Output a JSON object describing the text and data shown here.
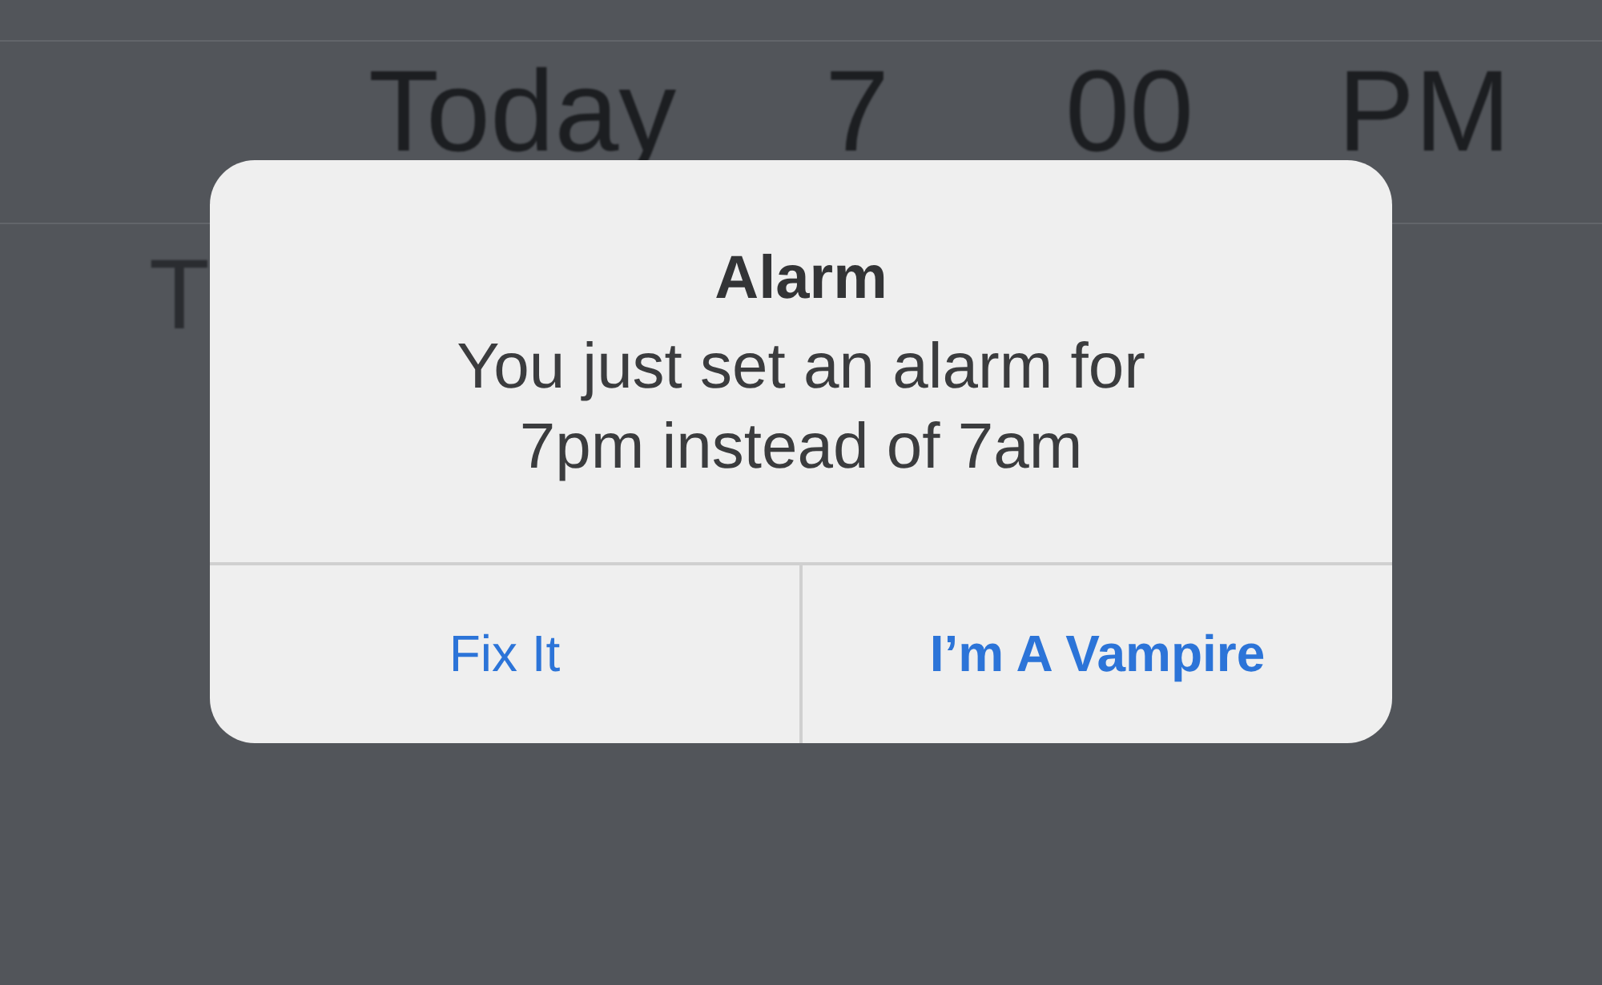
{
  "picker": {
    "rows": [
      {
        "selected": true,
        "cells": [
          "Today",
          "7",
          "00",
          "PM"
        ]
      },
      {
        "selected": false,
        "cells": [
          "T"
        ]
      }
    ]
  },
  "alert": {
    "title": "Alarm",
    "message": "You just set an alarm for\n7pm instead of 7am",
    "buttons": [
      {
        "label": "Fix It",
        "kind": "normal"
      },
      {
        "label": "I’m A Vampire",
        "kind": "preferred"
      }
    ]
  }
}
